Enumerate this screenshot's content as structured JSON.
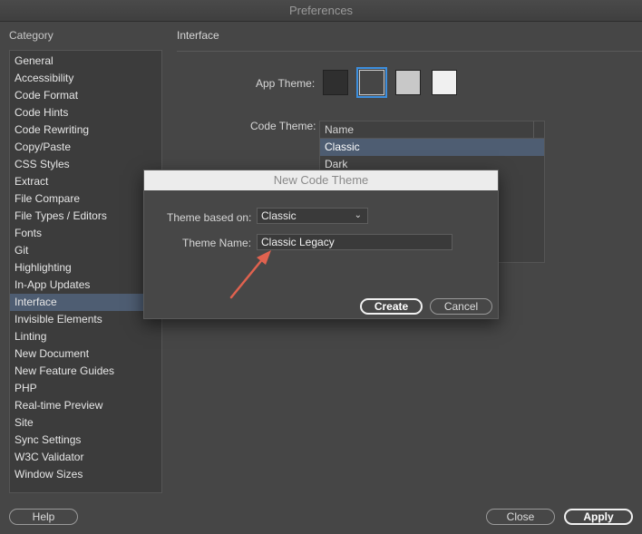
{
  "window": {
    "title": "Preferences"
  },
  "sidebar": {
    "header": "Category",
    "items": [
      {
        "label": "General"
      },
      {
        "label": "Accessibility"
      },
      {
        "label": "Code Format"
      },
      {
        "label": "Code Hints"
      },
      {
        "label": "Code Rewriting"
      },
      {
        "label": "Copy/Paste"
      },
      {
        "label": "CSS Styles"
      },
      {
        "label": "Extract"
      },
      {
        "label": "File Compare"
      },
      {
        "label": "File Types / Editors"
      },
      {
        "label": "Fonts"
      },
      {
        "label": "Git"
      },
      {
        "label": "Highlighting"
      },
      {
        "label": "In-App Updates"
      },
      {
        "label": "Interface",
        "selected": true
      },
      {
        "label": "Invisible Elements"
      },
      {
        "label": "Linting"
      },
      {
        "label": "New Document"
      },
      {
        "label": "New Feature Guides"
      },
      {
        "label": "PHP"
      },
      {
        "label": "Real-time Preview"
      },
      {
        "label": "Site"
      },
      {
        "label": "Sync Settings"
      },
      {
        "label": "W3C Validator"
      },
      {
        "label": "Window Sizes"
      }
    ]
  },
  "main": {
    "section_title": "Interface",
    "app_theme_label": "App Theme:",
    "app_theme_swatches": [
      "#2f2f2f",
      "#464646",
      "#c8c8c8",
      "#f0f0f0"
    ],
    "app_theme_selected": 1,
    "code_theme_label": "Code Theme:",
    "code_theme_list": {
      "column_header": "Name",
      "rows": [
        {
          "label": "Classic",
          "selected": true
        },
        {
          "label": "Dark"
        }
      ]
    }
  },
  "dialog": {
    "title": "New Code Theme",
    "based_on_label": "Theme based on:",
    "based_on_value": "Classic",
    "name_label": "Theme Name:",
    "name_value": "Classic Legacy",
    "create_label": "Create",
    "cancel_label": "Cancel"
  },
  "footer": {
    "help_label": "Help",
    "close_label": "Close",
    "apply_label": "Apply"
  },
  "colors": {
    "selection": "#4e5d72",
    "focus_ring": "#3d8fde",
    "annotation_arrow": "#e0624f"
  }
}
